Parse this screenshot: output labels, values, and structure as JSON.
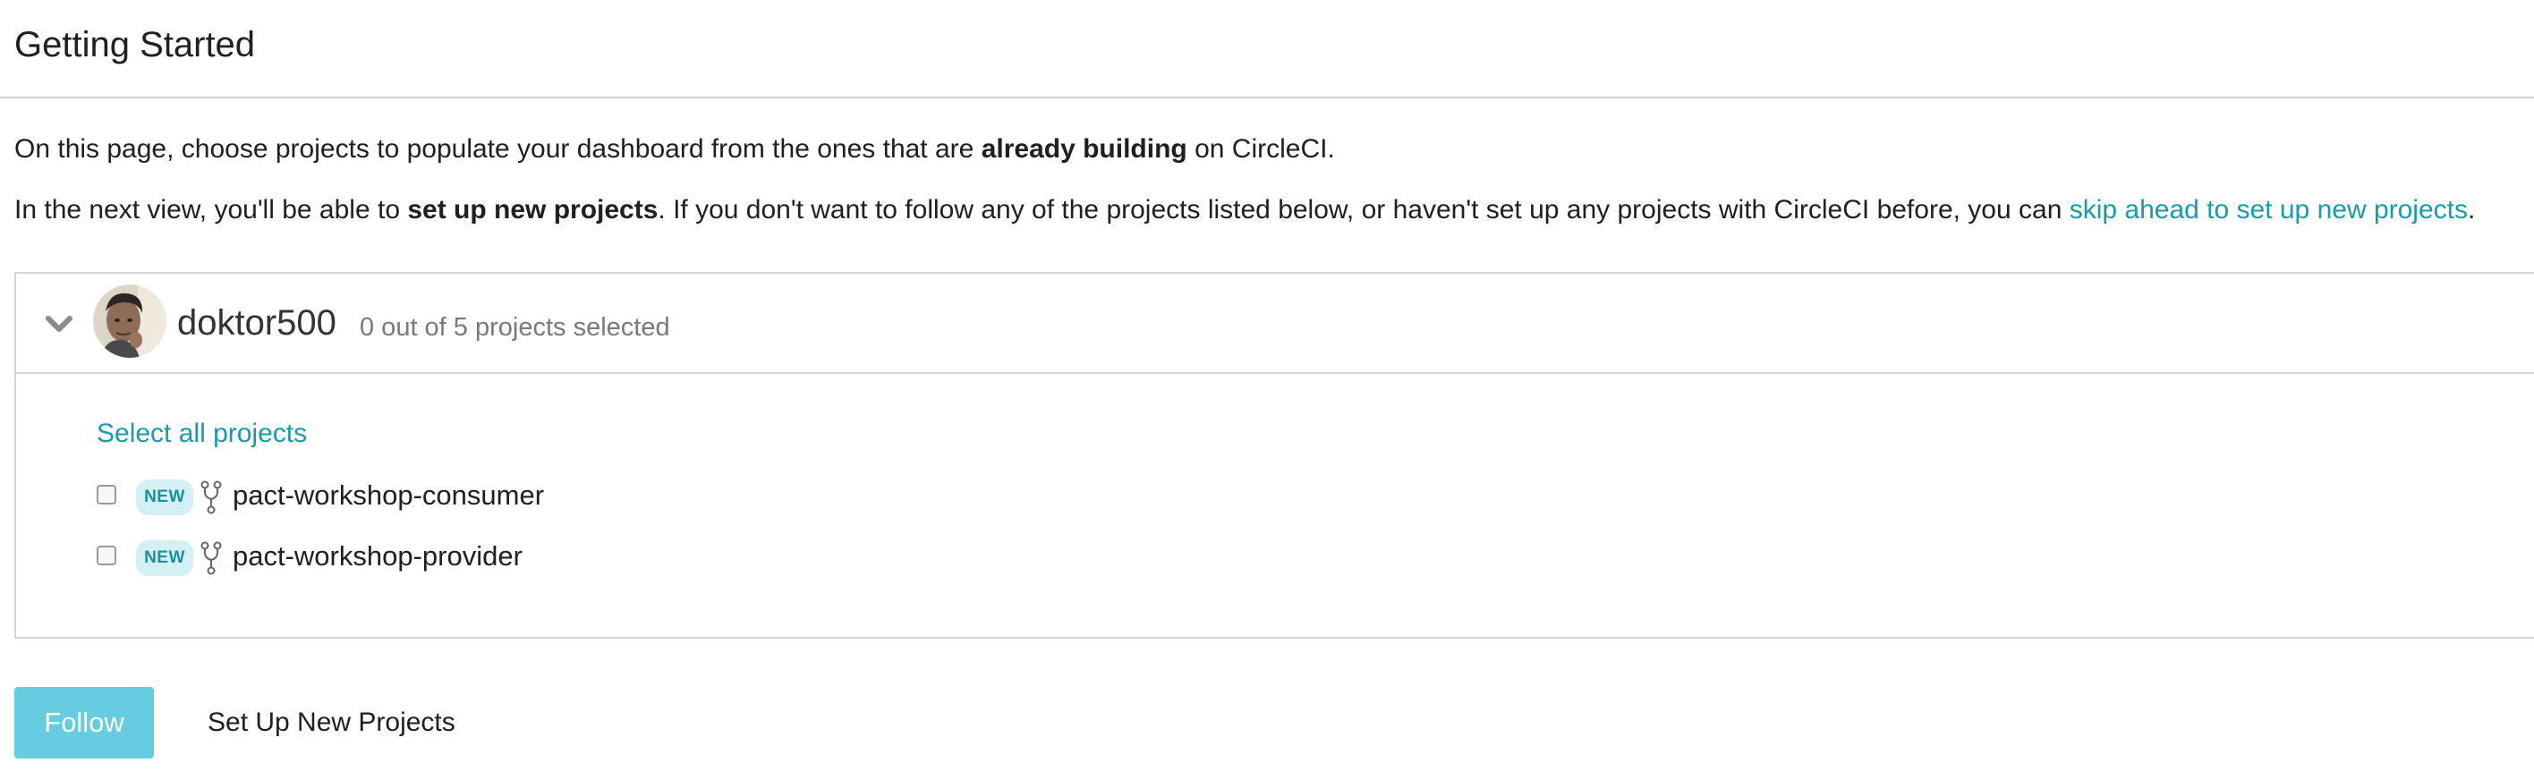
{
  "page": {
    "title": "Getting Started"
  },
  "intro": {
    "line1_part1": "On this page, choose projects to populate your dashboard from the ones that are ",
    "line1_bold": "already building",
    "line1_part2": " on CircleCI.",
    "line2_part1": "In the next view, you'll be able to ",
    "line2_bold": "set up new projects",
    "line2_part2": ". If you don't want to follow any of the projects listed below, or haven't set up any projects with CircleCI before, you can ",
    "line2_link": "skip ahead to set up new projects",
    "line2_part3": "."
  },
  "org": {
    "name": "doktor500",
    "selected_text": "0 out of 5 projects selected",
    "select_all_label": "Select all projects",
    "projects": [
      {
        "badge": "NEW",
        "name": "pact-workshop-consumer",
        "checked": false
      },
      {
        "badge": "NEW",
        "name": "pact-workshop-provider",
        "checked": false
      }
    ]
  },
  "actions": {
    "follow_label": "Follow",
    "setup_label": "Set Up New Projects"
  },
  "colors": {
    "accent": "#1a9bab",
    "follow_button": "#66cde0",
    "badge_bg": "#d4f0f5"
  }
}
